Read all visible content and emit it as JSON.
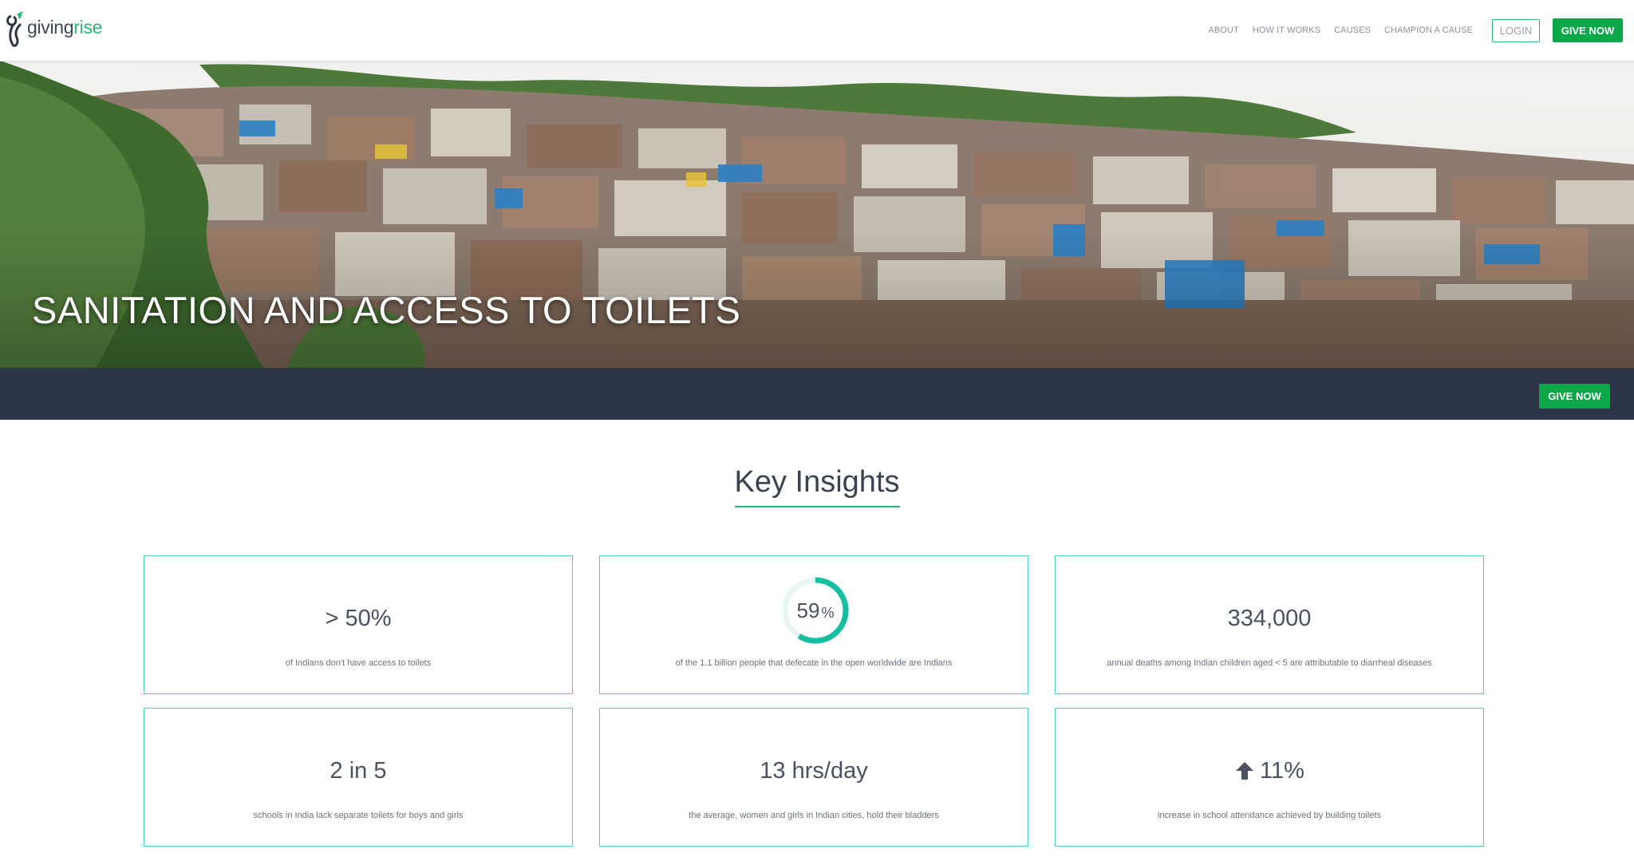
{
  "brand": {
    "name_part1": "giving",
    "name_part2": "rise",
    "green": "#2bb673"
  },
  "nav": {
    "links": [
      "ABOUT",
      "HOW IT WORKS",
      "CAUSES",
      "CHAMPION A CAUSE"
    ],
    "login_label": "LOGIN",
    "give_label": "GIVE NOW"
  },
  "hero": {
    "title": "SANITATION AND ACCESS TO TOILETS"
  },
  "bar": {
    "give_label": "GIVE NOW",
    "bg_color": "#2c3648"
  },
  "insights": {
    "title": "Key Insights",
    "cards": [
      {
        "value": "> 50%",
        "desc": "of Indians don't have access to toilets"
      },
      {
        "value": "59",
        "unit": "%",
        "ring_fraction": 0.59,
        "desc": "of the 1.1 billion people that defecate in the open worldwide are Indians"
      },
      {
        "value": "334,000",
        "desc": "annual deaths among Indian children aged < 5 are attributable to diarrheal diseases"
      },
      {
        "value": "2 in 5",
        "desc": "schools in India lack separate toilets for boys and girls"
      },
      {
        "value": "13 hrs/day",
        "desc": "the average, women and girls in Indian cities, hold their bladders"
      },
      {
        "value": "11%",
        "icon": "arrow-up-icon",
        "desc": "increase in school attendance achieved by building toilets"
      }
    ]
  }
}
